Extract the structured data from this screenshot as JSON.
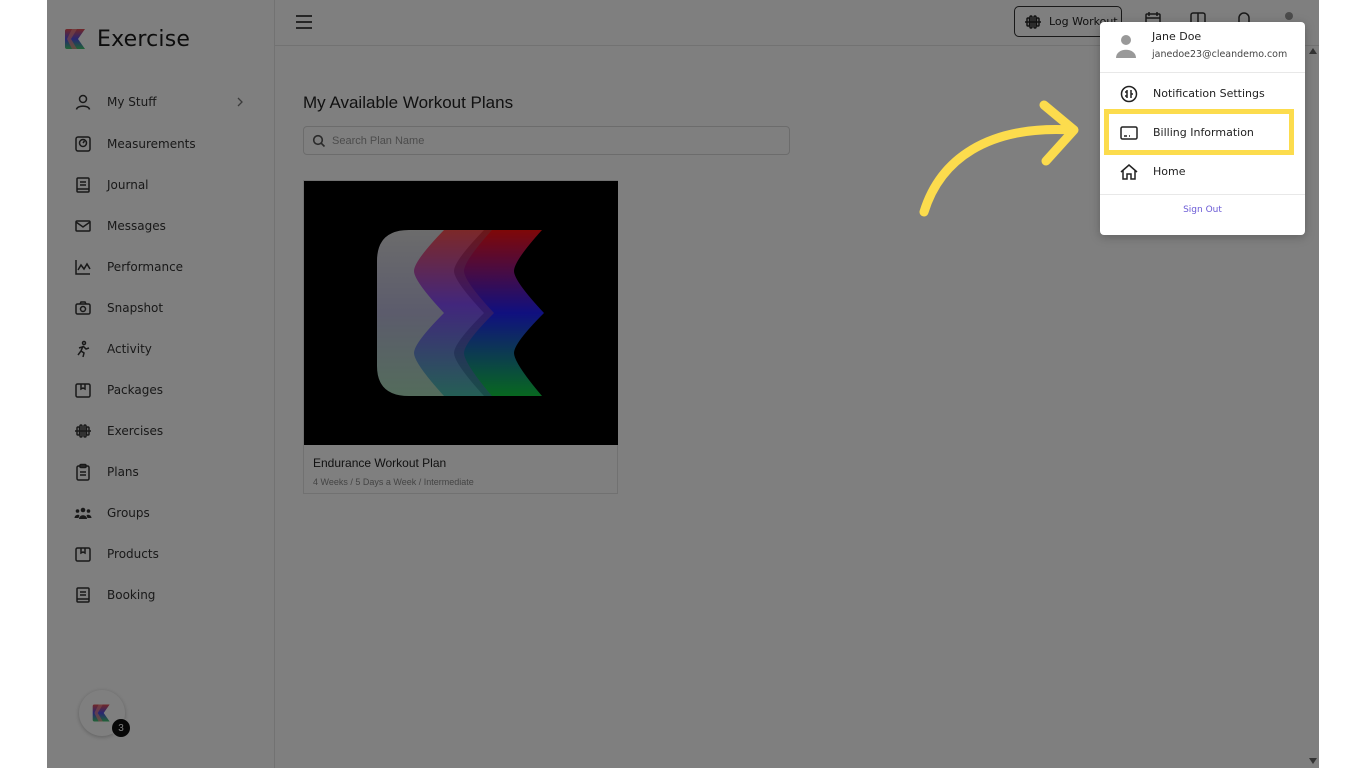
{
  "app": {
    "title": "Exercise"
  },
  "sidebar": {
    "items": [
      {
        "label": "My Stuff",
        "icon": "user-icon",
        "has_chevron": true
      },
      {
        "label": "Measurements",
        "icon": "scale-icon"
      },
      {
        "label": "Journal",
        "icon": "journal-icon"
      },
      {
        "label": "Messages",
        "icon": "envelope-icon"
      },
      {
        "label": "Performance",
        "icon": "chart-icon"
      },
      {
        "label": "Snapshot",
        "icon": "camera-icon"
      },
      {
        "label": "Activity",
        "icon": "running-icon"
      },
      {
        "label": "Packages",
        "icon": "package-icon"
      },
      {
        "label": "Exercises",
        "icon": "dumbbell-icon"
      },
      {
        "label": "Plans",
        "icon": "clipboard-icon"
      },
      {
        "label": "Groups",
        "icon": "group-icon"
      },
      {
        "label": "Products",
        "icon": "product-icon"
      },
      {
        "label": "Booking",
        "icon": "book-icon"
      }
    ],
    "notification_count": "3"
  },
  "topbar": {
    "log_workout_label": "Log Workout"
  },
  "main": {
    "page_title": "My Available Workout Plans",
    "search_placeholder": "Search Plan Name",
    "plans": [
      {
        "title": "Endurance Workout Plan",
        "meta": "4 Weeks / 5 Days a Week / Intermediate"
      }
    ]
  },
  "user_menu": {
    "name": "Jane Doe",
    "email": "janedoe23@cleandemo.com",
    "items": [
      {
        "label": "Notification Settings",
        "icon": "notification-settings-icon"
      },
      {
        "label": "Billing Information",
        "icon": "billing-card-icon"
      },
      {
        "label": "Home",
        "icon": "home-icon"
      }
    ],
    "sign_out": "Sign Out"
  },
  "colors": {
    "highlight": "#fcdc4d",
    "arrow": "#fcdc4d",
    "sign_out": "#6b5bd6",
    "overlay": "rgba(0,0,0,0.5)"
  }
}
